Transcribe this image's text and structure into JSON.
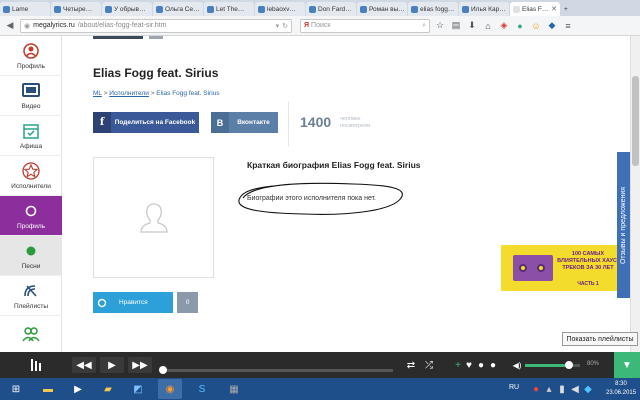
{
  "browser": {
    "tabs": [
      {
        "label": "Lame"
      },
      {
        "label": "Четыре…"
      },
      {
        "label": "У обрыв…"
      },
      {
        "label": "Ольга Се…"
      },
      {
        "label": "Let The…"
      },
      {
        "label": "lebaoxv…"
      },
      {
        "label": "Don Fard…"
      },
      {
        "label": "Роман вы…"
      },
      {
        "label": "elias fogg…"
      },
      {
        "label": "Илья Кар…"
      },
      {
        "label": "Elias F…",
        "active": true
      }
    ],
    "url_host": "megalyrics.ru",
    "url_path": "/about/elias-fogg-feat-sir.htm",
    "search_placeholder": "Поиск"
  },
  "sidebar": {
    "items": [
      {
        "label": "Профиль",
        "icon": "profile-icon"
      },
      {
        "label": "Видео",
        "icon": "tv-icon"
      },
      {
        "label": "Афиша",
        "icon": "calendar-icon"
      },
      {
        "label": "Исполнители",
        "icon": "star-icon"
      },
      {
        "label": "Профиль",
        "icon": "circle-icon",
        "active": true
      },
      {
        "label": "Песни",
        "icon": "dot-icon"
      },
      {
        "label": "Плейлисты",
        "icon": "satellite-icon"
      },
      {
        "label": "",
        "icon": "people-icon"
      }
    ]
  },
  "artist": {
    "name": "Elias Fogg feat. Sirius",
    "breadcrumb": {
      "root": "ML",
      "section": "Исполнители",
      "current": "Elias Fogg feat. Sirius",
      "sep": ">"
    }
  },
  "share": {
    "facebook_label": "Поделиться на Facebook",
    "vk_label": "Вконтакте",
    "count": "1400",
    "count_caption_line1": "человек",
    "count_caption_line2": "посмотрели"
  },
  "bio": {
    "title": "Краткая биография Elias Fogg feat. Sirius",
    "text": "Биографии этого исполнителя пока нет."
  },
  "like": {
    "label": "Нравится",
    "count": "0"
  },
  "banner": {
    "text": "100 САМЫХ ВЛИЯТЕЛЬНЫХ ХАУС-ТРЕКОВ ЗА 30 ЛЕТ",
    "sub": "ЧАСТЬ 1"
  },
  "feedback_label": "Отзывы и предложения",
  "tooltip": "Показать плейлисты",
  "player": {
    "volume_percent": 80,
    "volume_label": "80%",
    "progress_percent": 0
  },
  "taskbar": {
    "lang": "RU",
    "time": "8:30",
    "date": "23.06.2015"
  },
  "colors": {
    "sidebar_active": "#8c2f9c",
    "facebook": "#3b5998",
    "vk": "#5b7fa6",
    "like": "#2d9fd9",
    "player_accent": "#3cb878",
    "banner": "#f3dc2c"
  }
}
